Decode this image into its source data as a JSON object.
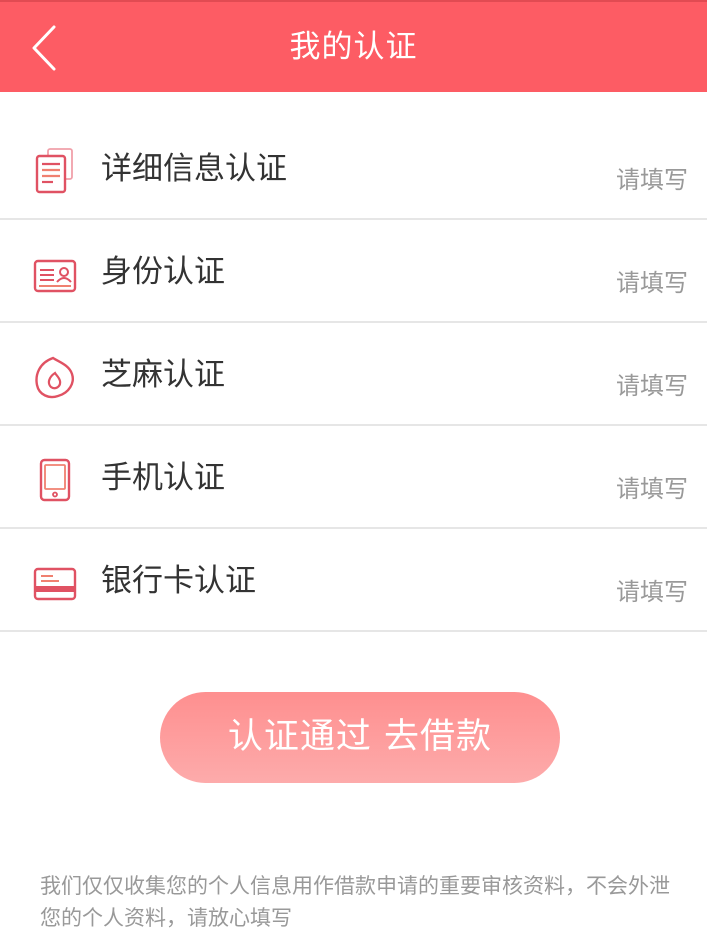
{
  "header": {
    "title": "我的认证",
    "back_icon": "chevron-left-icon"
  },
  "colors": {
    "header_bg": "#fd5c64",
    "accent": "#e05263",
    "button_start": "#fe8f8f",
    "button_end": "#fdabab",
    "muted_text": "#999999"
  },
  "items": [
    {
      "label": "详细信息认证",
      "status": "请填写",
      "icon": "document-icon"
    },
    {
      "label": "身份认证",
      "status": "请填写",
      "icon": "id-card-icon"
    },
    {
      "label": "芝麻认证",
      "status": "请填写",
      "icon": "sesame-icon"
    },
    {
      "label": "手机认证",
      "status": "请填写",
      "icon": "phone-icon"
    },
    {
      "label": "银行卡认证",
      "status": "请填写",
      "icon": "bank-card-icon"
    }
  ],
  "submit": {
    "label": "认证通过 去借款"
  },
  "notice": "我们仅仅收集您的个人信息用作借款申请的重要审核资料，不会外泄您的个人资料，请放心填写"
}
